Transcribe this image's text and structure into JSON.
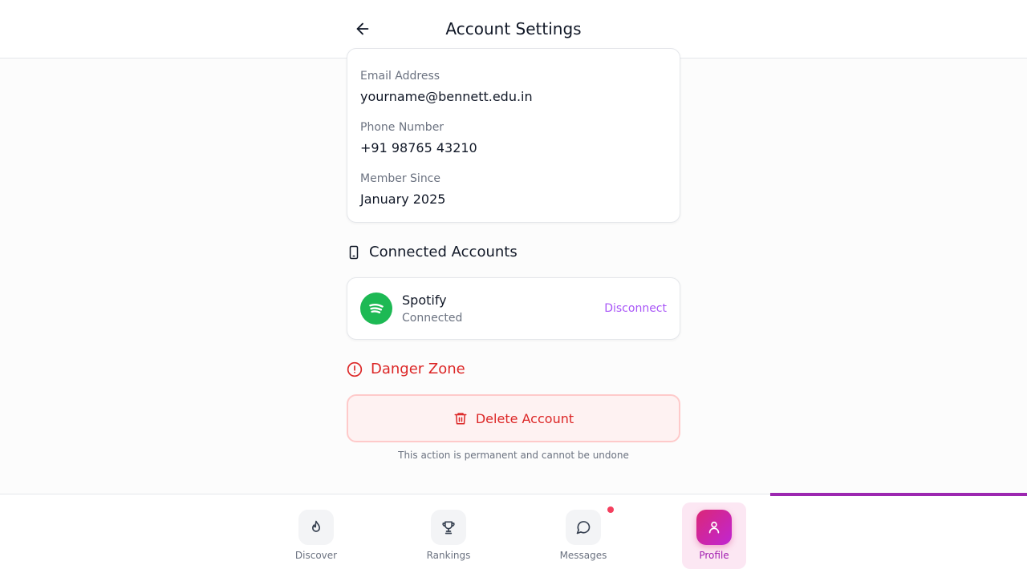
{
  "header": {
    "title": "Account Settings",
    "back_icon": "arrow-left-icon"
  },
  "account_info": {
    "fields": [
      {
        "label": "Email Address",
        "value": "yourname@bennett.edu.in"
      },
      {
        "label": "Phone Number",
        "value": "+91 98765 43210"
      },
      {
        "label": "Member Since",
        "value": "January 2025"
      }
    ]
  },
  "connected_accounts": {
    "heading": "Connected Accounts",
    "icon": "smartphone-icon",
    "items": [
      {
        "name": "Spotify",
        "status": "Connected",
        "action": "Disconnect",
        "color": "#1db954"
      }
    ]
  },
  "danger_zone": {
    "heading": "Danger Zone",
    "icon": "alert-circle-icon",
    "delete_label": "Delete Account",
    "note": "This action is permanent and cannot be undone",
    "color": "#dc2626"
  },
  "nav": {
    "items": [
      {
        "label": "Discover",
        "icon": "flame-icon"
      },
      {
        "label": "Rankings",
        "icon": "trophy-icon"
      },
      {
        "label": "Messages",
        "icon": "chat-icon"
      },
      {
        "label": "Profile",
        "icon": "user-icon"
      }
    ],
    "active": "Profile",
    "accent": "#db2777"
  }
}
